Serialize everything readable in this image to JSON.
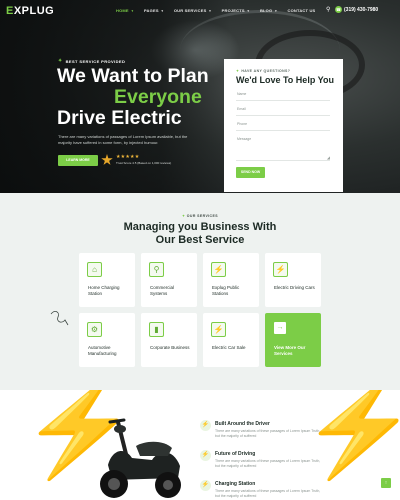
{
  "brand": {
    "logo_prefix": "E",
    "logo_rest": "XPLUG",
    "accent_color": "#7ccd47"
  },
  "nav": {
    "items": [
      {
        "label": "HOME",
        "active": true,
        "has_caret": true
      },
      {
        "label": "PAGES",
        "active": false,
        "has_caret": true
      },
      {
        "label": "OUR SERVICES",
        "active": false,
        "has_caret": true
      },
      {
        "label": "PROJECTS",
        "active": false,
        "has_caret": true
      },
      {
        "label": "BLOG",
        "active": false,
        "has_caret": true
      },
      {
        "label": "CONTACT US",
        "active": false,
        "has_caret": false
      }
    ],
    "search_icon": "search-icon",
    "phone_icon": "phone-icon",
    "phone": "(319) 430-7980"
  },
  "hero": {
    "eyebrow": "BEST SERVICE PROVIDED",
    "title_line1": "We Want to Plan",
    "title_line2": "Everyone",
    "title_line3": "Drive Electric",
    "description": "There are many variations of passages of Lorem Ipsum available, but the majority have suffered in some form, by injected humour.",
    "cta_label": "LEARN MORE",
    "stars": "★★★★★",
    "rating_text": "Trust Score 4.5 (Based on 1,000 reviews)"
  },
  "form": {
    "eyebrow": "HAVE ANY QUESTIONS?",
    "title": "We'd Love To Help You",
    "name_placeholder": "Name",
    "email_placeholder": "Email",
    "phone_placeholder": "Phone",
    "message_placeholder": "Message",
    "submit_label": "SEND NOW"
  },
  "services": {
    "eyebrow": "OUR SERVICES",
    "title_line1": "Managing you Business With",
    "title_line2": "Our Best Service",
    "cards": [
      {
        "label": "Home Charging Station",
        "icon": "home-charger-icon"
      },
      {
        "label": "Commercial Systems",
        "icon": "plug-icon"
      },
      {
        "label": "Explug Public Stations",
        "icon": "charging-station-icon"
      },
      {
        "label": "Electric Driving Cars",
        "icon": "electric-car-icon"
      },
      {
        "label": "Automotive Manufacturing",
        "icon": "gear-icon"
      },
      {
        "label": "Corporate Business",
        "icon": "battery-icon"
      },
      {
        "label": "Electric Car Sale",
        "icon": "car-sale-icon"
      },
      {
        "label": "View More Our Services",
        "icon": "arrow-right-icon"
      }
    ]
  },
  "features": {
    "items": [
      {
        "title": "Built Around the Driver",
        "desc": "There are many variations of these passages of Lorem Ipsum Truth, but the majority of suffered",
        "icon": "driver-icon"
      },
      {
        "title": "Future of Driving",
        "desc": "There are many variations of these passages of Lorem Ipsum Truth, but the majority of suffered",
        "icon": "future-icon"
      },
      {
        "title": "Charging Station",
        "desc": "There are many variations of these passages of Lorem Ipsum Truth, but the majority of suffered",
        "icon": "charging-icon"
      }
    ],
    "scroll_top_icon": "arrow-up-icon"
  }
}
